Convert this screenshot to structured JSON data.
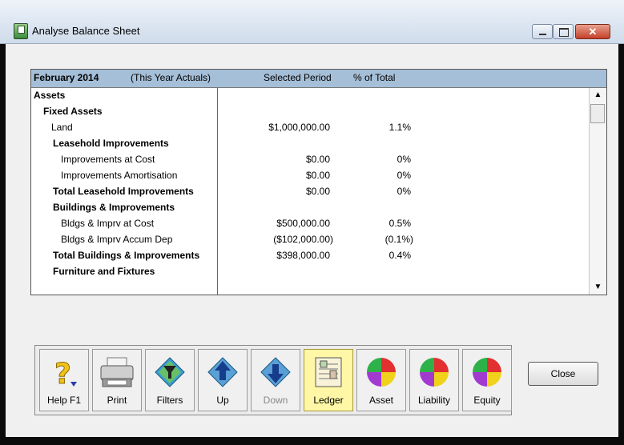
{
  "window": {
    "title": "Analyse Balance Sheet"
  },
  "grid": {
    "header": {
      "period": "February 2014",
      "type": "(This Year Actuals)",
      "col_period": "Selected Period",
      "col_pct": "% of Total"
    },
    "rows": [
      {
        "label": "Assets",
        "amount": "",
        "pct": ""
      },
      {
        "label": "Fixed Assets",
        "amount": "",
        "pct": ""
      },
      {
        "label": "Land",
        "amount": "$1,000,000.00",
        "pct": "1.1%"
      },
      {
        "label": "Leasehold Improvements",
        "amount": "",
        "pct": ""
      },
      {
        "label": "Improvements at Cost",
        "amount": "$0.00",
        "pct": "0%"
      },
      {
        "label": "Improvements Amortisation",
        "amount": "$0.00",
        "pct": "0%"
      },
      {
        "label": "Total Leasehold Improvements",
        "amount": "$0.00",
        "pct": "0%"
      },
      {
        "label": "Buildings & Improvements",
        "amount": "",
        "pct": ""
      },
      {
        "label": "Bldgs & Imprv at Cost",
        "amount": "$500,000.00",
        "pct": "0.5%"
      },
      {
        "label": "Bldgs & Imprv Accum Dep",
        "amount": "($102,000.00)",
        "pct": "(0.1%)"
      },
      {
        "label": "Total Buildings & Improvements",
        "amount": "$398,000.00",
        "pct": "0.4%"
      },
      {
        "label": "Furniture and Fixtures",
        "amount": "",
        "pct": ""
      }
    ]
  },
  "toolbar": {
    "help": "Help F1",
    "print": "Print",
    "filters": "Filters",
    "up": "Up",
    "down": "Down",
    "ledger": "Ledger",
    "asset": "Asset",
    "liability": "Liability",
    "equity": "Equity"
  },
  "close_label": "Close",
  "icons": {
    "help": "question-icon",
    "print": "printer-icon",
    "filters": "filter-icon",
    "up": "up-arrow-icon",
    "down": "down-arrow-icon",
    "ledger": "ledger-icon",
    "asset": "pie-chart-icon",
    "liability": "pie-chart-icon",
    "equity": "pie-chart-icon"
  },
  "colors": {
    "header_bg": "#a6bfd8",
    "ledger_active": "#fff7a6"
  }
}
